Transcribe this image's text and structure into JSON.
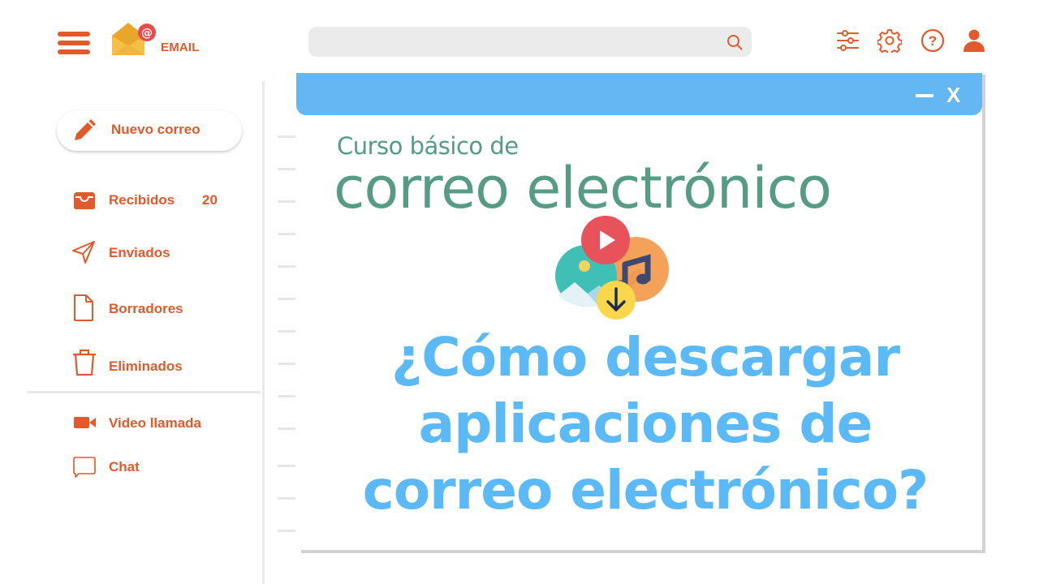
{
  "header": {
    "logo_text": "EMAIL",
    "search": {
      "value": "",
      "placeholder": ""
    },
    "icons": [
      "filters-icon",
      "settings-icon",
      "help-icon",
      "user-icon"
    ]
  },
  "sidebar": {
    "compose_label": "Nuevo correo",
    "items": [
      {
        "label": "Recibidos",
        "count": "20",
        "icon": "inbox-icon"
      },
      {
        "label": "Enviados",
        "icon": "send-icon"
      },
      {
        "label": "Borradores",
        "icon": "draft-icon"
      },
      {
        "label": "Eliminados",
        "icon": "trash-icon"
      }
    ],
    "secondary_items": [
      {
        "label": "Video llamada",
        "icon": "video-icon"
      },
      {
        "label": "Chat",
        "icon": "chat-icon"
      }
    ]
  },
  "window": {
    "minimize_label": "",
    "close_label": "X",
    "course_subtitle": "Curso básico de",
    "course_title": "correo electrónico",
    "headline_lines": [
      "¿Cómo descargar",
      "aplicaciones de",
      "correo electrónico?"
    ]
  },
  "colors": {
    "accent": "#e05a2b",
    "titlebar": "#64b7f3",
    "headline": "#5bbaf5",
    "course_text": "#569b83",
    "search_bg": "#ebebeb"
  }
}
